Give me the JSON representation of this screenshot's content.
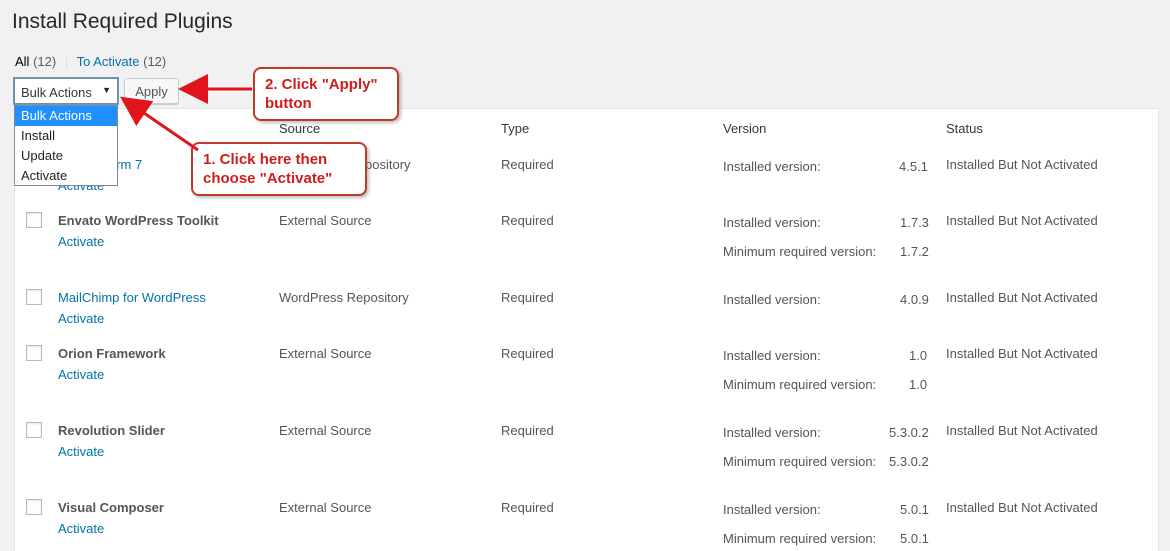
{
  "page": {
    "title": "Install Required Plugins"
  },
  "filters": {
    "all_label": "All",
    "all_count": "(12)",
    "separator": "|",
    "to_activate_label": "To Activate",
    "to_activate_count": "(12)"
  },
  "bulk": {
    "selected": "Bulk Actions",
    "options": [
      "Bulk Actions",
      "Install",
      "Update",
      "Activate"
    ],
    "apply_label": "Apply"
  },
  "table": {
    "headers": {
      "source": "Source",
      "type": "Type",
      "version": "Version",
      "status": "Status"
    },
    "rows": [
      {
        "name": "Contact Form 7",
        "visible_name": "orm 7",
        "action": "Activate",
        "source": "WordPress Repository",
        "visible_source": "pository",
        "type": "Required",
        "installed_label": "Installed version:",
        "installed": "4.5.1",
        "status": "Installed But Not Activated"
      },
      {
        "name": "Envato WordPress Toolkit",
        "action": "Activate",
        "source": "External Source",
        "type": "Required",
        "installed_label": "Installed version:",
        "installed": "1.7.3",
        "min_label": "Minimum required version:",
        "min": "1.7.2",
        "status": "Installed But Not Activated"
      },
      {
        "name": "MailChimp for WordPress",
        "action": "Activate",
        "source": "WordPress Repository",
        "type": "Required",
        "installed_label": "Installed version:",
        "installed": "4.0.9",
        "status": "Installed But Not Activated"
      },
      {
        "name": "Orion Framework",
        "action": "Activate",
        "source": "External Source",
        "type": "Required",
        "installed_label": "Installed version:",
        "installed": "1.0",
        "min_label": "Minimum required version:",
        "min": "1.0",
        "status": "Installed But Not Activated"
      },
      {
        "name": "Revolution Slider",
        "action": "Activate",
        "source": "External Source",
        "type": "Required",
        "installed_label": "Installed version:",
        "installed": "5.3.0.2",
        "min_label": "Minimum required version:",
        "min": "5.3.0.2",
        "status": "Installed But Not Activated"
      },
      {
        "name": "Visual Composer",
        "action": "Activate",
        "source": "External Source",
        "type": "Required",
        "installed_label": "Installed version:",
        "installed": "5.0.1",
        "min_label": "Minimum required version:",
        "min": "5.0.1",
        "status": "Installed But Not Activated"
      }
    ]
  },
  "annotations": {
    "step1_line1": "1. Click here then",
    "step1_line2": "choose \"Activate\"",
    "step2_line1": "2. Click \"Apply\"",
    "step2_line2": "button"
  },
  "colors": {
    "link": "#0073aa",
    "callout_text": "#d01c1c",
    "callout_border": "#c0392b",
    "selected_option": "#1e90ff"
  }
}
